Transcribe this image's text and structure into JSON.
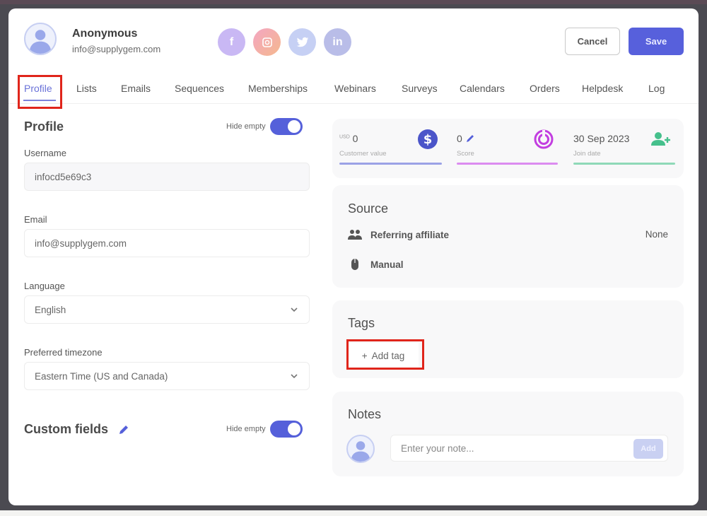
{
  "header": {
    "user_name": "Anonymous",
    "user_email": "info@supplygem.com",
    "socials": [
      {
        "name": "facebook",
        "glyph": "f"
      },
      {
        "name": "instagram",
        "glyph": "◻"
      },
      {
        "name": "twitter",
        "glyph": "🐦"
      },
      {
        "name": "linkedin",
        "glyph": "in"
      }
    ],
    "cancel_label": "Cancel",
    "save_label": "Save"
  },
  "tabs": [
    {
      "label": "Profile",
      "active": true
    },
    {
      "label": "Lists"
    },
    {
      "label": "Emails"
    },
    {
      "label": "Sequences"
    },
    {
      "label": "Memberships"
    },
    {
      "label": "Webinars"
    },
    {
      "label": "Surveys"
    },
    {
      "label": "Calendars"
    },
    {
      "label": "Orders"
    },
    {
      "label": "Helpdesk"
    },
    {
      "label": "Log"
    }
  ],
  "profile": {
    "title": "Profile",
    "hide_empty_label": "Hide empty",
    "hide_empty_on": true,
    "fields": {
      "username_label": "Username",
      "username_value": "infocd5e69c3",
      "email_label": "Email",
      "email_value": "info@supplygem.com",
      "language_label": "Language",
      "language_value": "English",
      "timezone_label": "Preferred timezone",
      "timezone_value": "Eastern Time (US and Canada)"
    }
  },
  "custom_fields": {
    "title": "Custom fields",
    "hide_empty_label": "Hide empty",
    "hide_empty_on": true
  },
  "stats": [
    {
      "currency": "USD",
      "value": "0",
      "label": "Customer value",
      "icon": "dollar-icon",
      "color": "#4b55c9",
      "bar_color": "#9ba2e6"
    },
    {
      "value": "0",
      "label": "Score",
      "icon": "target-icon",
      "color": "#c23ee0",
      "bar_color": "#dc8cf0"
    },
    {
      "value": "30 Sep 2023",
      "label": "Join date",
      "icon": "user-plus-icon",
      "color": "#45c08c",
      "bar_color": "#8fd9b8"
    }
  ],
  "source": {
    "title": "Source",
    "rows": [
      {
        "icon": "people-icon",
        "label": "Referring affiliate",
        "value": "None"
      },
      {
        "icon": "mouse-icon",
        "label": "Manual",
        "value": ""
      }
    ]
  },
  "tags": {
    "title": "Tags",
    "add_label": "Add tag"
  },
  "notes": {
    "title": "Notes",
    "placeholder": "Enter your note...",
    "add_label": "Add"
  }
}
